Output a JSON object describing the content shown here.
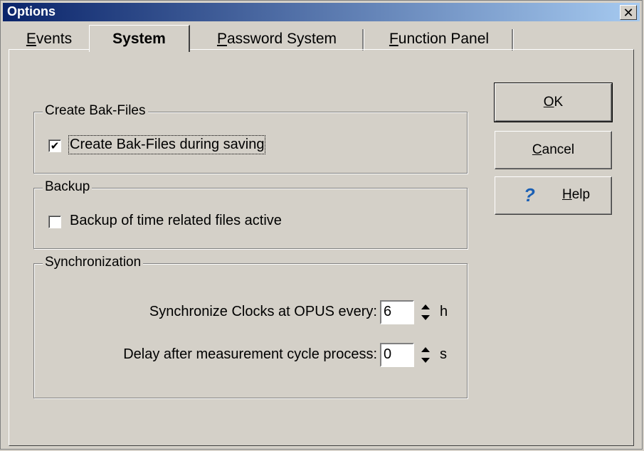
{
  "window": {
    "title": "Options",
    "close_glyph": "✕"
  },
  "tabs": [
    {
      "label_u": "E",
      "label_rest": "vents"
    },
    {
      "label_u": "",
      "label_rest": "System"
    },
    {
      "label_u": "P",
      "label_rest": "assword System"
    },
    {
      "label_u": "F",
      "label_rest": "unction Panel"
    }
  ],
  "groups": {
    "bak": {
      "legend": "Create Bak-Files",
      "checkbox_label": "Create Bak-Files during saving",
      "checked": true
    },
    "backup": {
      "legend": "Backup",
      "checkbox_label": "Backup of time related files active",
      "checked": false
    },
    "sync": {
      "legend": "Synchronization",
      "clock_label": "Synchronize Clocks at OPUS every:",
      "clock_value": "6",
      "clock_unit": "h",
      "delay_label": "Delay after measurement cycle process:",
      "delay_value": "0",
      "delay_unit": "s"
    }
  },
  "buttons": {
    "ok_u": "O",
    "ok_rest": "K",
    "cancel_u": "C",
    "cancel_rest": "ancel",
    "help_u": "H",
    "help_rest": "elp",
    "help_icon": "?"
  },
  "check_glyph": "✔"
}
